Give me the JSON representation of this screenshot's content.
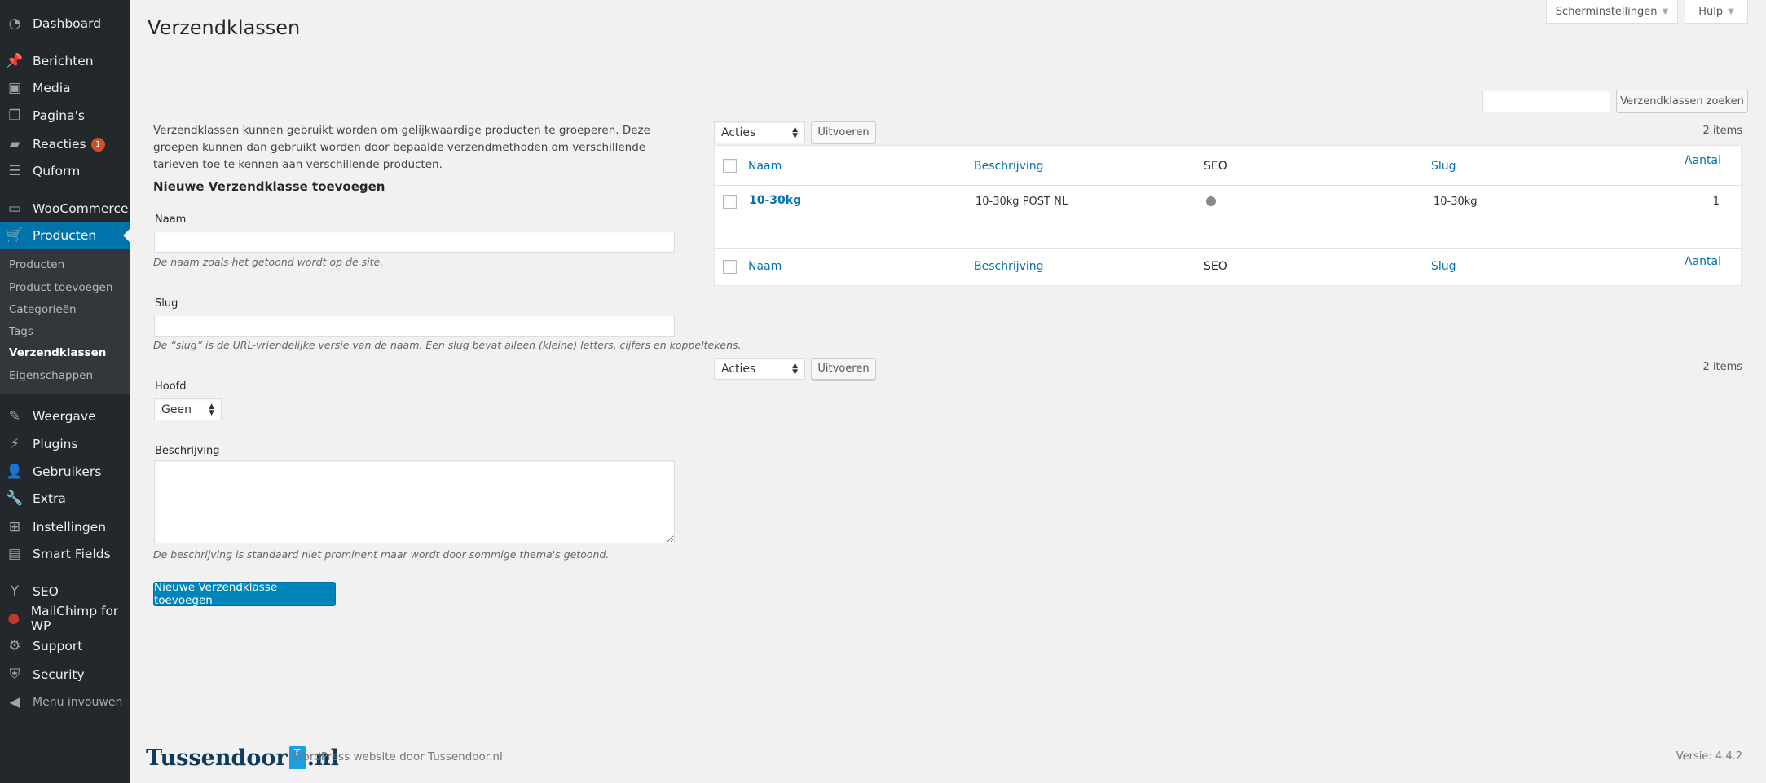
{
  "sidebar": {
    "items": [
      {
        "label": "Dashboard",
        "icon": "dashboard-icon"
      },
      {
        "label": "Berichten",
        "icon": "pin-icon"
      },
      {
        "label": "Media",
        "icon": "media-icon"
      },
      {
        "label": "Pagina's",
        "icon": "pages-icon"
      },
      {
        "label": "Reacties",
        "icon": "comment-icon",
        "badge": "1"
      },
      {
        "label": "Quform",
        "icon": "form-icon"
      },
      {
        "label": "WooCommerce",
        "icon": "woo-icon"
      },
      {
        "label": "Producten",
        "icon": "cart-icon",
        "active": true
      },
      {
        "label": "Weergave",
        "icon": "brush-icon"
      },
      {
        "label": "Plugins",
        "icon": "plug-icon"
      },
      {
        "label": "Gebruikers",
        "icon": "user-icon"
      },
      {
        "label": "Extra",
        "icon": "wrench-icon"
      },
      {
        "label": "Instellingen",
        "icon": "settings-icon"
      },
      {
        "label": "Smart Fields",
        "icon": "smart-fields-icon"
      },
      {
        "label": "SEO",
        "icon": "yoast-icon"
      },
      {
        "label": "MailChimp for WP",
        "icon": "mailchimp-icon"
      },
      {
        "label": "Support",
        "icon": "gear-icon"
      },
      {
        "label": "Security",
        "icon": "shield-icon"
      }
    ],
    "submenu": [
      "Producten",
      "Product toevoegen",
      "Categorieën",
      "Tags",
      "Verzendklassen",
      "Eigenschappen"
    ],
    "current_sub": "Verzendklassen",
    "collapse": "Menu invouwen"
  },
  "header": {
    "title": "Verzendklassen",
    "screen_options": "Scherminstellingen",
    "help": "Hulp"
  },
  "search": {
    "value": "",
    "button": "Verzendklassen zoeken"
  },
  "form": {
    "intro": "Verzendklassen kunnen gebruikt worden om gelijkwaardige producten te groeperen. Deze groepen kunnen dan gebruikt worden door bepaalde verzendmethoden om verschillende tarieven toe te kennen aan verschillende producten.",
    "heading": "Nieuwe Verzendklasse toevoegen",
    "name_label": "Naam",
    "name_value": "",
    "name_help": "De naam zoals het getoond wordt op de site.",
    "slug_label": "Slug",
    "slug_value": "",
    "slug_help": "De “slug” is de URL-vriendelijke versie van de naam. Een slug bevat alleen (kleine) letters, cijfers en koppeltekens.",
    "parent_label": "Hoofd",
    "parent_value": "Geen",
    "desc_label": "Beschrijving",
    "desc_value": "",
    "desc_help": "De beschrijving is standaard niet prominent maar wordt door sommige thema's getoond.",
    "submit": "Nieuwe Verzendklasse toevoegen"
  },
  "list": {
    "bulk_action": "Acties",
    "apply": "Uitvoeren",
    "count": "2 items",
    "columns": [
      "Naam",
      "Beschrijving",
      "SEO",
      "Slug",
      "Aantal"
    ],
    "rows": [
      {
        "name": "10-30kg",
        "description": "10-30kg POST NL",
        "seo": "grey",
        "slug": "10-30kg",
        "count": "1"
      }
    ]
  },
  "footer": {
    "logo": "Tussendoor.nl",
    "credit": "WordPress website door Tussendoor.nl",
    "version": "Versie: 4.4.2"
  },
  "colors": {
    "sidebar": "#23282d",
    "accent": "#0073aa",
    "primary_button": "#0085ba",
    "badge": "#d54e21"
  }
}
